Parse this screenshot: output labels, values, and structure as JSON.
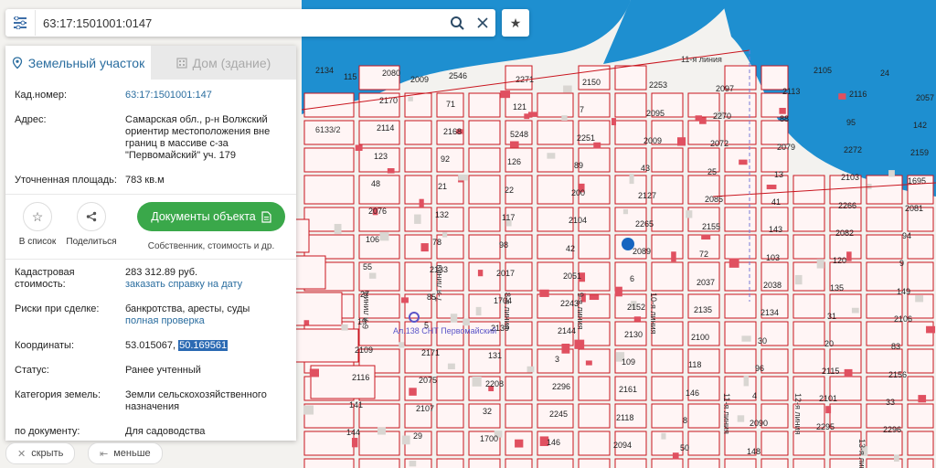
{
  "search": {
    "value": "63:17:1501001:0147"
  },
  "tabs": [
    {
      "label": "Земельный участок"
    },
    {
      "label": "Дом (здание)"
    }
  ],
  "info": {
    "kad_label": "Кад.номер:",
    "kad_value": "63:17:1501001:147",
    "addr_label": "Адрес:",
    "addr_line1": "Самарская обл., р-н Волжский",
    "addr_line2": "ориентир местоположения вне",
    "addr_line3": "границ в массиве с-за",
    "addr_line4": "\"Первомайский\" уч. 179",
    "area_label": "Уточненная площадь:",
    "area_value": "783 кв.м"
  },
  "actions": {
    "list_label": "В список",
    "share_label": "Поделиться",
    "docs_label": "Документы объекта",
    "docs_sub": "Собственник, стоимость и др."
  },
  "details": {
    "cost_label1": "Кадастровая",
    "cost_label2": "стоимость:",
    "cost_value": "283 312.89 руб.",
    "cost_link": "заказать справку на дату",
    "risk_label": "Риски при сделке:",
    "risk_value": "банкротства, аресты, суды",
    "risk_link": "полная проверка",
    "coord_label": "Координаты:",
    "coord_lat": "53.015067,",
    "coord_lon": "50.169561",
    "status_label": "Статус:",
    "status_value": "Ранее учтенный",
    "cat_label": "Категория земель:",
    "cat_value1": "Земли сельскохозяйственного",
    "cat_value2": "назначения",
    "doc_label": "по документу:",
    "doc_value": "Для садоводства"
  },
  "footer": {
    "hide_label": "скрыть",
    "less_label": "меньше"
  },
  "map": {
    "water_color": "#1e8fd0",
    "parcel_stroke": "#c9151e",
    "parcel_fill": "#fff5f5",
    "marker_color": "#1565c0",
    "marker_label": "Ал.138 СНТ Первомайский",
    "streets": [
      "11-я линия",
      "6133/2",
      "8-я линия",
      "9-я линия",
      "10-я линия",
      "11-я линия",
      "12-я линия",
      "13-я линия",
      "6-я линия",
      "7-я линия"
    ],
    "numbers": [
      "2134",
      "2080",
      "2546",
      "2271",
      "2150",
      "2253",
      "2097",
      "2113",
      "2116",
      "2057",
      "2170",
      "71",
      "121",
      "7",
      "2095",
      "2270",
      "88",
      "95",
      "142",
      "2114",
      "2168",
      "5248",
      "2251",
      "2009",
      "2072",
      "2079",
      "2272",
      "2159",
      "123",
      "92",
      "126",
      "89",
      "43",
      "25",
      "13",
      "2103",
      "1695",
      "48",
      "21",
      "22",
      "200",
      "2127",
      "2085",
      "41",
      "2266",
      "2081",
      "2076",
      "132",
      "117",
      "2104",
      "2265",
      "2155",
      "143",
      "2082",
      "94",
      "106",
      "78",
      "98",
      "42",
      "2089",
      "72",
      "103",
      "120",
      "9",
      "55",
      "2133",
      "2017",
      "2051",
      "6",
      "2037",
      "2038",
      "135",
      "149",
      "27",
      "85",
      "1704",
      "2243",
      "2152",
      "2135",
      "2134",
      "31",
      "2106",
      "19",
      "5",
      "2139",
      "2144",
      "2130",
      "2100",
      "30",
      "20",
      "83",
      "2109",
      "2171",
      "131",
      "3",
      "109",
      "118",
      "96",
      "2115",
      "2156",
      "2116",
      "2075",
      "2208",
      "2296",
      "2161",
      "146",
      "4",
      "2101",
      "33",
      "141",
      "2107",
      "32",
      "2245",
      "2118",
      "8",
      "2090",
      "2295",
      "2296",
      "144",
      "29",
      "1700",
      "146",
      "2094",
      "50",
      "148",
      "2105",
      "24",
      "115",
      "2009"
    ]
  }
}
